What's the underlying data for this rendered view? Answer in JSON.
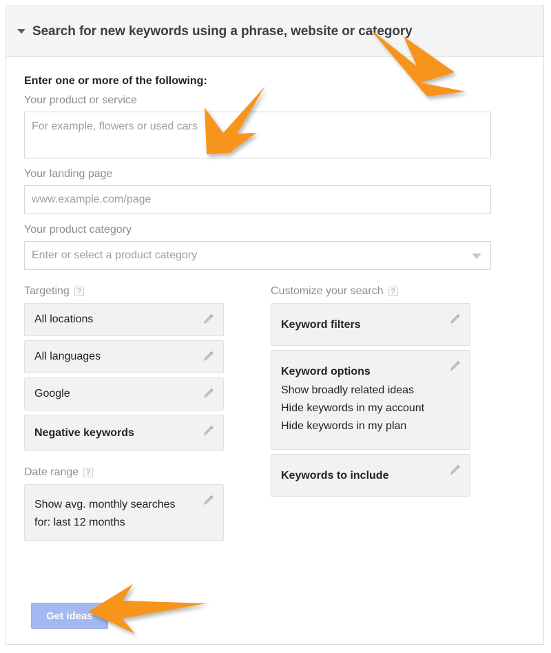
{
  "header": {
    "title": "Search for new keywords using a phrase, website or category",
    "disclosure_icon": "caret-down-icon"
  },
  "form": {
    "intro_label": "Enter one or more of the following:",
    "product_or_service": {
      "label": "Your product or service",
      "placeholder": "For example, flowers or used cars",
      "value": ""
    },
    "landing_page": {
      "label": "Your landing page",
      "placeholder": "www.example.com/page",
      "value": ""
    },
    "product_category": {
      "label": "Your product category",
      "placeholder": "Enter or select a product category",
      "value": "Enter or select a product category",
      "caret_icon": "chevron-down-icon"
    }
  },
  "targeting": {
    "title": "Targeting",
    "help_icon": "question-mark-icon",
    "items": [
      {
        "label": "All locations",
        "bold": false,
        "edit_icon": "pencil-icon"
      },
      {
        "label": "All languages",
        "bold": false,
        "edit_icon": "pencil-icon"
      },
      {
        "label": "Google",
        "bold": false,
        "edit_icon": "pencil-icon"
      },
      {
        "label": "Negative keywords",
        "bold": true,
        "edit_icon": "pencil-icon"
      }
    ]
  },
  "date_range": {
    "title": "Date range",
    "help_icon": "question-mark-icon",
    "line1": "Show avg. monthly searches",
    "line2": "for: last 12 months",
    "edit_icon": "pencil-icon"
  },
  "customize": {
    "title": "Customize your search",
    "help_icon": "question-mark-icon",
    "keyword_filters": {
      "label": "Keyword filters",
      "edit_icon": "pencil-icon"
    },
    "keyword_options": {
      "label": "Keyword options",
      "edit_icon": "pencil-icon",
      "lines": [
        "Show broadly related ideas",
        "Hide keywords in my account",
        "Hide keywords in my plan"
      ]
    },
    "keywords_to_include": {
      "label": "Keywords to include",
      "edit_icon": "pencil-icon"
    }
  },
  "actions": {
    "get_ideas_label": "Get ideas"
  },
  "annotations": {
    "arrow_color": "#F7941E",
    "arrows": [
      {
        "name": "arrow-to-panel-title",
        "points_to": "header-title"
      },
      {
        "name": "arrow-to-product-input",
        "points_to": "product-or-service-input"
      },
      {
        "name": "arrow-to-get-ideas",
        "points_to": "get-ideas-button"
      }
    ]
  },
  "colors": {
    "header_bg": "#f5f5f5",
    "card_bg": "#f2f2f2",
    "button_bg": "#a4b9f2",
    "label_gray": "#8a8f95",
    "accent_orange": "#F7941E"
  }
}
